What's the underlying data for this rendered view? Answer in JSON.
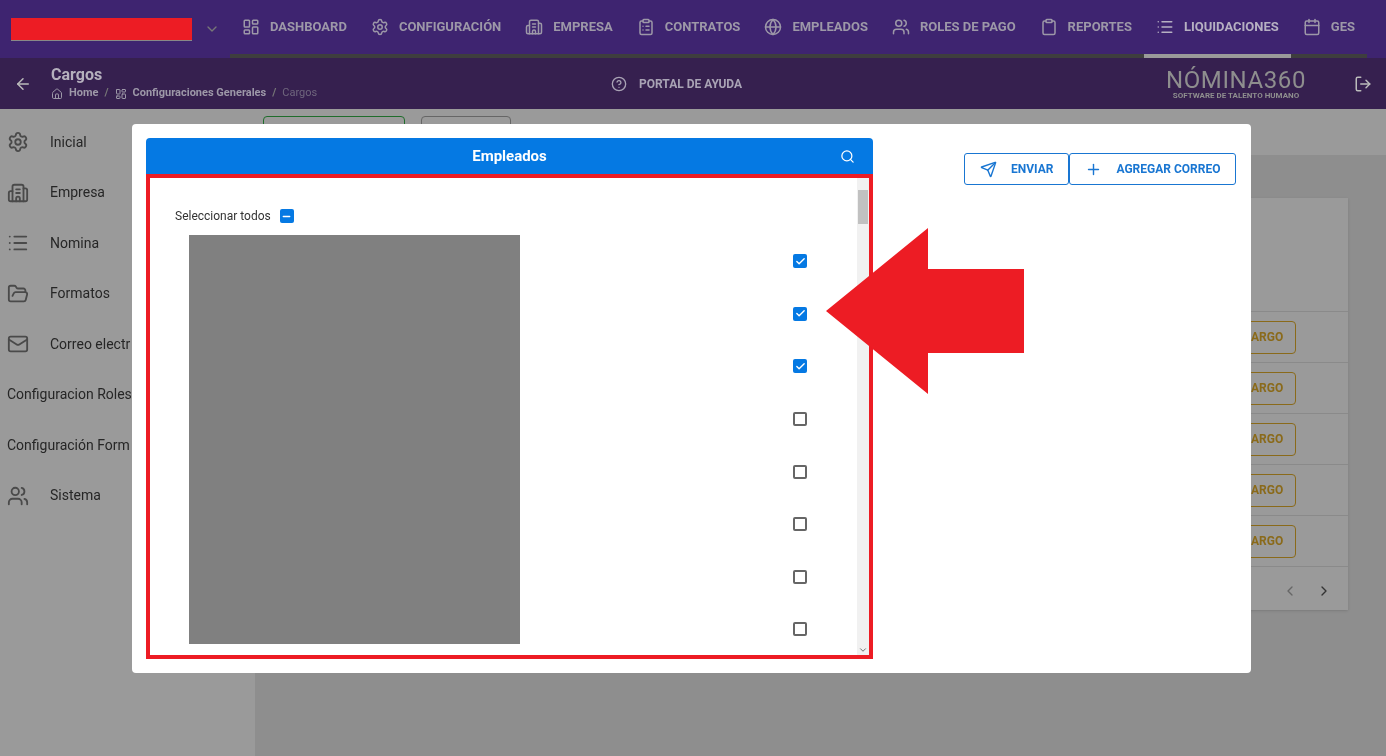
{
  "nav": {
    "items": [
      {
        "label": "DASHBOARD",
        "selected": false
      },
      {
        "label": "CONFIGURACIÓN",
        "selected": false
      },
      {
        "label": "EMPRESA",
        "selected": false
      },
      {
        "label": "CONTRATOS",
        "selected": false
      },
      {
        "label": "EMPLEADOS",
        "selected": false
      },
      {
        "label": "ROLES DE PAGO",
        "selected": false
      },
      {
        "label": "REPORTES",
        "selected": false
      },
      {
        "label": "LIQUIDACIONES",
        "selected": true
      },
      {
        "label": "GES",
        "selected": false
      }
    ]
  },
  "header": {
    "title": "Cargos",
    "breadcrumb": [
      "Home",
      "Configuraciones Generales",
      "Cargos"
    ],
    "breadcrumb_separators": [
      "/",
      "/"
    ],
    "help": "PORTAL DE AYUDA",
    "logo": "NÓMINA360",
    "logo_tagline": "SOFTWARE DE TALENTO HUMANO"
  },
  "sidebar": {
    "items": [
      {
        "label": "Inicial",
        "kind": "icon"
      },
      {
        "label": "Empresa",
        "kind": "icon"
      },
      {
        "label": "Nomina",
        "kind": "icon"
      },
      {
        "label": "Formatos",
        "kind": "icon"
      },
      {
        "label": "Correo electr",
        "kind": "icon"
      },
      {
        "label": "Configuracion Roles",
        "kind": "text"
      },
      {
        "label": "Configuración Form",
        "kind": "text"
      },
      {
        "label": "Sistema",
        "kind": "icon"
      }
    ]
  },
  "background_rows": [
    "ARGO",
    "ARGO",
    "ARGO",
    "ARGO",
    "ARGO"
  ],
  "dialog": {
    "panel_title": "Empleados",
    "select_all": {
      "label": "Seleccionar todos",
      "indeterminate": true
    },
    "employees": [
      {
        "checked": true
      },
      {
        "checked": true
      },
      {
        "checked": true
      },
      {
        "checked": false
      },
      {
        "checked": false
      },
      {
        "checked": false
      },
      {
        "checked": false
      },
      {
        "checked": false
      }
    ],
    "buttons": [
      "ENVIAR",
      "AGREGAR CORREO"
    ]
  }
}
